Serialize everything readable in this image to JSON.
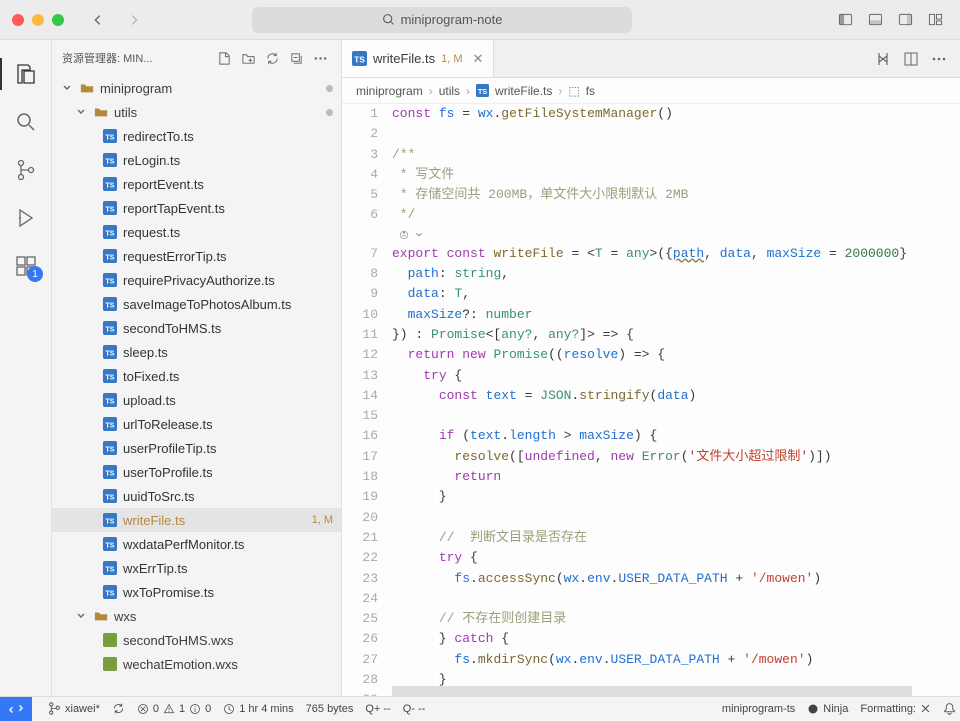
{
  "window": {
    "title": "miniprogram-note"
  },
  "activity": {
    "scm_badge": "1"
  },
  "sidebar": {
    "header": "资源管理器: MIN...",
    "folders": {
      "root": "miniprogram",
      "utils": "utils",
      "wxs": "wxs"
    },
    "files": [
      "redirectTo.ts",
      "reLogin.ts",
      "reportEvent.ts",
      "reportTapEvent.ts",
      "request.ts",
      "requestErrorTip.ts",
      "requirePrivacyAuthorize.ts",
      "saveImageToPhotosAlbum.ts",
      "secondToHMS.ts",
      "sleep.ts",
      "toFixed.ts",
      "upload.ts",
      "urlToRelease.ts",
      "userProfileTip.ts",
      "userToProfile.ts",
      "uuidToSrc.ts",
      "writeFile.ts",
      "wxdataPerfMonitor.ts",
      "wxErrTip.ts",
      "wxToPromise.ts"
    ],
    "wxs_files": [
      "secondToHMS.wxs",
      "wechatEmotion.wxs"
    ],
    "writefile_status": "1, M"
  },
  "tab": {
    "name": "writeFile.ts",
    "status": "1, M"
  },
  "breadcrumb": [
    "miniprogram",
    "utils",
    "writeFile.ts",
    "fs"
  ],
  "code": {
    "l1_a": "const",
    "l1_b": "fs",
    "l1_c": "wx",
    "l1_d": "getFileSystemManager",
    "l3": "/**",
    "l4": " * 写文件",
    "l5": " * 存储空间共 200MB，单文件大小限制默认 2MB",
    "l6": " */",
    "l7_export": "export",
    "l7_const": "const",
    "l7_name": "writeFile",
    "l7_any": "any",
    "l7_path": "path",
    "l7_data": "data",
    "l7_max": "maxSize",
    "l7_num": "2000000",
    "l8_path": "path",
    "l8_string": "string",
    "l9_data": "data",
    "l9_T": "T",
    "l10_max": "maxSize",
    "l10_num": "number",
    "l11_promise": "Promise",
    "l11_any": "any?",
    "l12_return": "return",
    "l12_new": "new",
    "l12_promise": "Promise",
    "l12_resolve": "resolve",
    "l13_try": "try",
    "l14_const": "const",
    "l14_text": "text",
    "l14_json": "JSON",
    "l14_str": "stringify",
    "l14_data": "data",
    "l16_if": "if",
    "l16_text": "text",
    "l16_len": "length",
    "l16_max": "maxSize",
    "l17_resolve": "resolve",
    "l17_undef": "undefined",
    "l17_new": "new",
    "l17_error": "Error",
    "l17_msg": "'文件大小超过限制'",
    "l18_return": "return",
    "l21_cm": "//  判断文目录是否存在",
    "l22_try": "try",
    "l23_fs": "fs",
    "l23_access": "accessSync",
    "l23_wx": "wx",
    "l23_env": "env",
    "l23_path": "USER_DATA_PATH",
    "l23_str": "'/mowen'",
    "l25_cm": "// 不存在则创建目录",
    "l26_catch": "catch",
    "l27_fs": "fs",
    "l27_mkdir": "mkdirSync",
    "l27_wx": "wx",
    "l27_env": "env",
    "l27_path": "USER_DATA_PATH",
    "l27_str": "'/mowen'"
  },
  "status": {
    "branch": "xiawei*",
    "sync": "",
    "errors": "0",
    "warnings": "1",
    "info": "0",
    "time": "1 hr 4 mins",
    "size": "765 bytes",
    "q_plus": "Q+ --",
    "q_minus": "Q- --",
    "lang": "miniprogram-ts",
    "formatting": "Formatting: ",
    "ninja": "Ninja"
  }
}
